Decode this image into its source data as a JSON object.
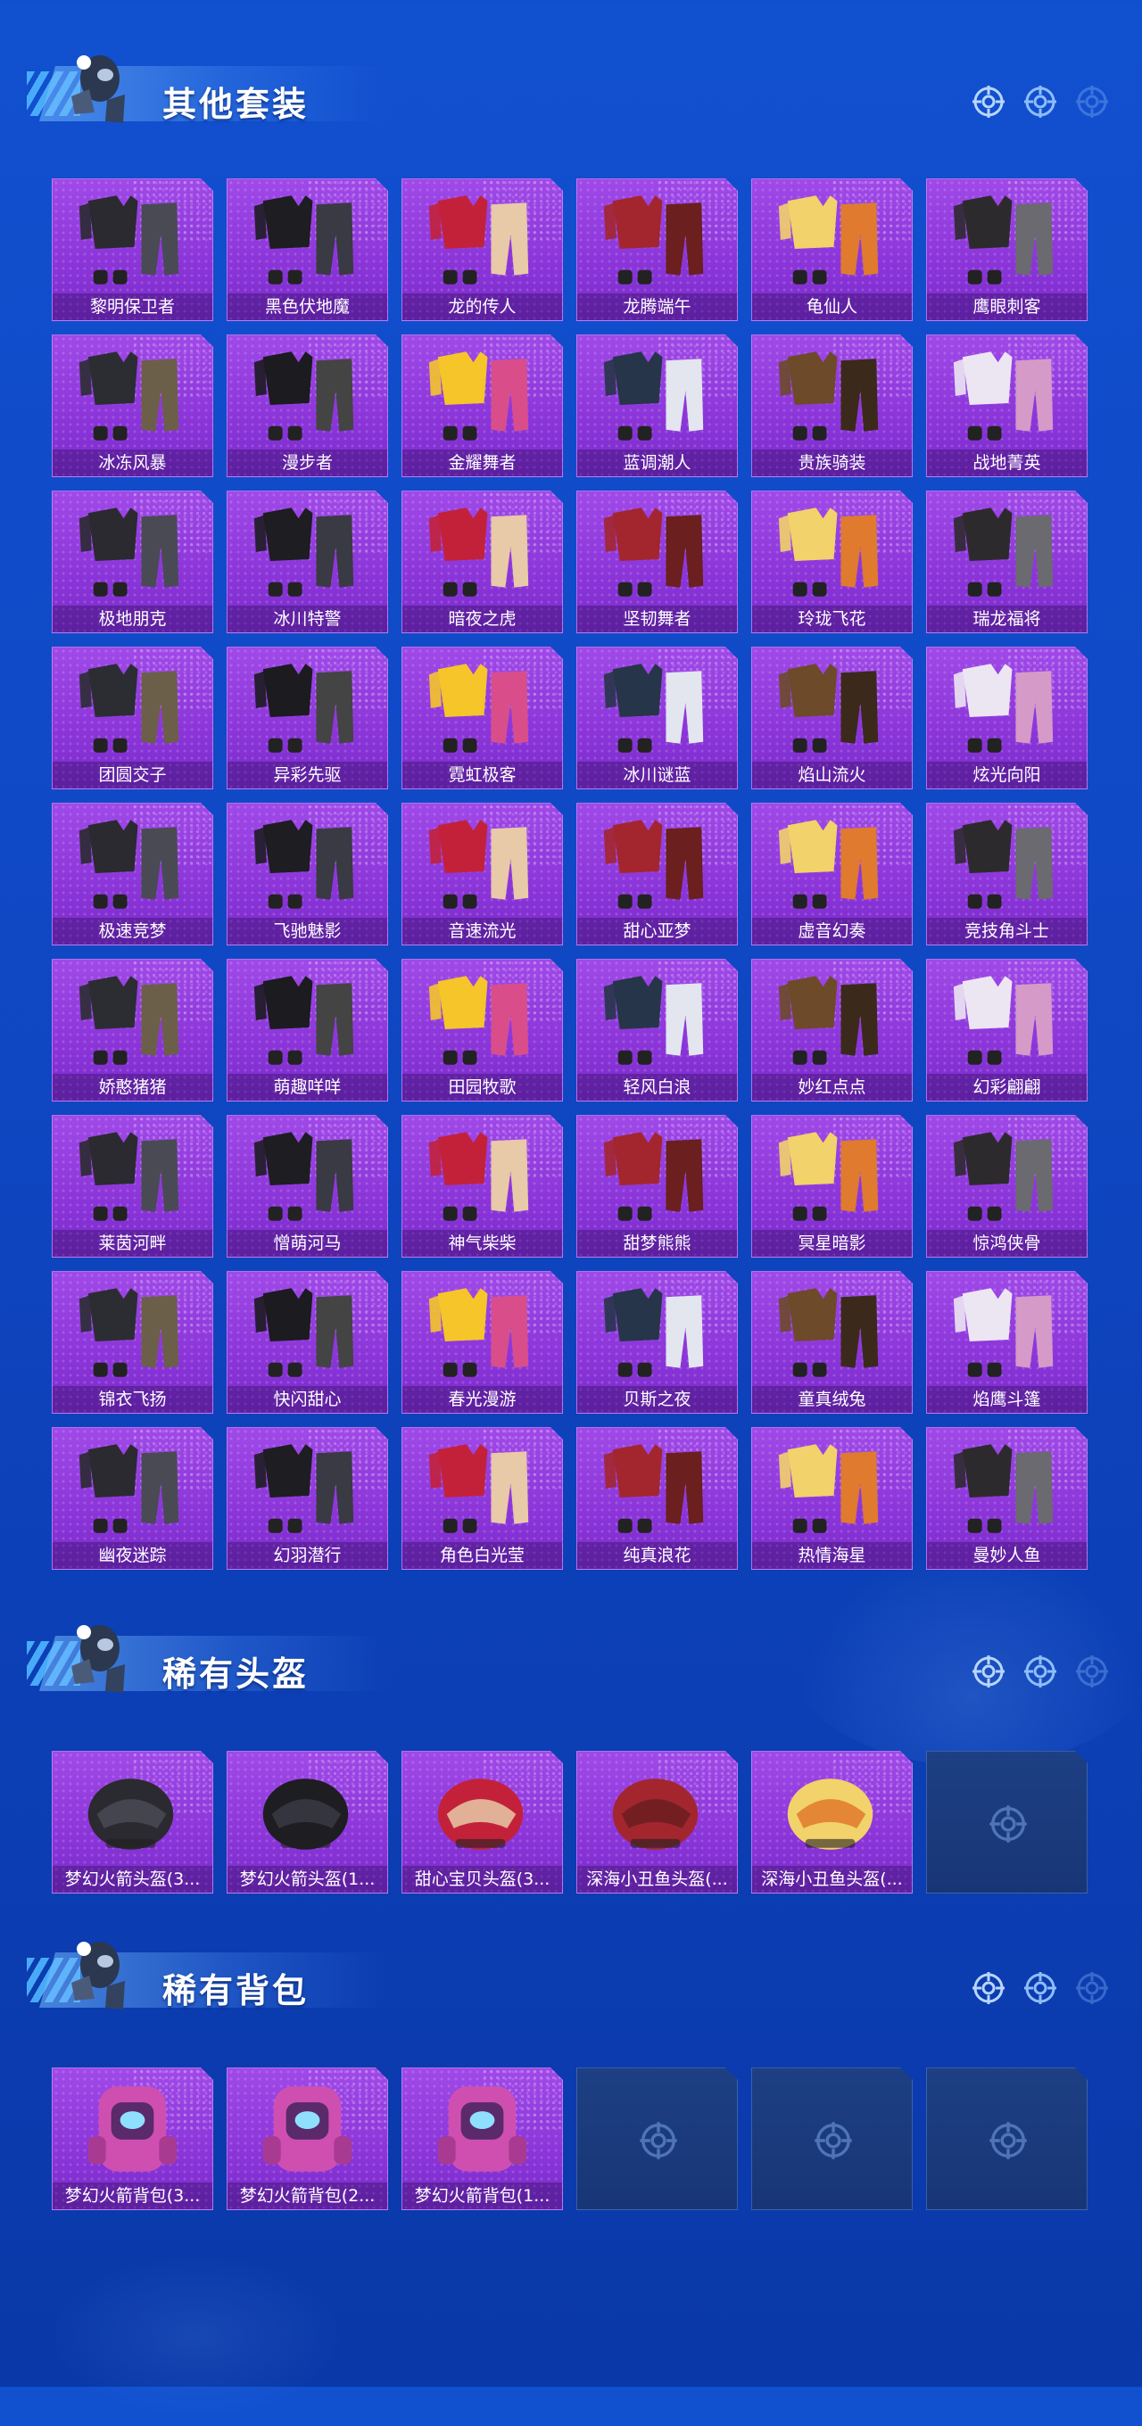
{
  "sections": [
    {
      "title": "其他套装",
      "items": [
        {
          "name": "黎明保卫者"
        },
        {
          "name": "黑色伏地魔"
        },
        {
          "name": "龙的传人"
        },
        {
          "name": "龙腾端午"
        },
        {
          "name": "龟仙人"
        },
        {
          "name": "鹰眼刺客"
        },
        {
          "name": "冰冻风暴"
        },
        {
          "name": "漫步者"
        },
        {
          "name": "金耀舞者"
        },
        {
          "name": "蓝调潮人"
        },
        {
          "name": "贵族骑装"
        },
        {
          "name": "战地菁英"
        },
        {
          "name": "极地朋克"
        },
        {
          "name": "冰川特警"
        },
        {
          "name": "暗夜之虎"
        },
        {
          "name": "坚韧舞者"
        },
        {
          "name": "玲珑飞花"
        },
        {
          "name": "瑞龙福将"
        },
        {
          "name": "团圆交子"
        },
        {
          "name": "异彩先驱"
        },
        {
          "name": "霓虹极客"
        },
        {
          "name": "冰川谜蓝"
        },
        {
          "name": "焰山流火"
        },
        {
          "name": "炫光向阳"
        },
        {
          "name": "极速竞梦"
        },
        {
          "name": "飞驰魅影"
        },
        {
          "name": "音速流光"
        },
        {
          "name": "甜心亚梦"
        },
        {
          "name": "虚音幻奏"
        },
        {
          "name": "竞技角斗士"
        },
        {
          "name": "娇憨猪猪"
        },
        {
          "name": "萌趣咩咩"
        },
        {
          "name": "田园牧歌"
        },
        {
          "name": "轻风白浪"
        },
        {
          "name": "妙红点点"
        },
        {
          "name": "幻彩翩翩"
        },
        {
          "name": "莱茵河畔"
        },
        {
          "name": "憎萌河马"
        },
        {
          "name": "神气柴柴"
        },
        {
          "name": "甜梦熊熊"
        },
        {
          "name": "冥星暗影"
        },
        {
          "name": "惊鸿侠骨"
        },
        {
          "name": "锦衣飞扬"
        },
        {
          "name": "快闪甜心"
        },
        {
          "name": "春光漫游"
        },
        {
          "name": "贝斯之夜"
        },
        {
          "name": "童真绒兔"
        },
        {
          "name": "焰鹰斗篷"
        },
        {
          "name": "幽夜迷踪"
        },
        {
          "name": "幻羽潜行"
        },
        {
          "name": "角色白光莹"
        },
        {
          "name": "纯真浪花"
        },
        {
          "name": "热情海星"
        },
        {
          "name": "曼妙人鱼"
        }
      ]
    },
    {
      "title": "稀有头盔",
      "items": [
        {
          "name": "梦幻火箭头盔(3..."
        },
        {
          "name": "梦幻火箭头盔(1..."
        },
        {
          "name": "甜心宝贝头盔(3..."
        },
        {
          "name": "深海小丑鱼头盔(..."
        },
        {
          "name": "深海小丑鱼头盔(..."
        },
        {
          "name": ""
        }
      ]
    },
    {
      "title": "稀有背包",
      "items": [
        {
          "name": "梦幻火箭背包(3..."
        },
        {
          "name": "梦幻火箭背包(2..."
        },
        {
          "name": "梦幻火箭背包(1..."
        },
        {
          "name": ""
        },
        {
          "name": ""
        },
        {
          "name": ""
        }
      ]
    }
  ],
  "colors": {
    "card_purple": "#8b35d9",
    "card_empty": "#1d3f83",
    "background": "#1150cf"
  },
  "icons": {
    "header_target": "crosshair-icon",
    "empty_slot": "crosshair-icon",
    "mascot": "mascot-icon"
  }
}
